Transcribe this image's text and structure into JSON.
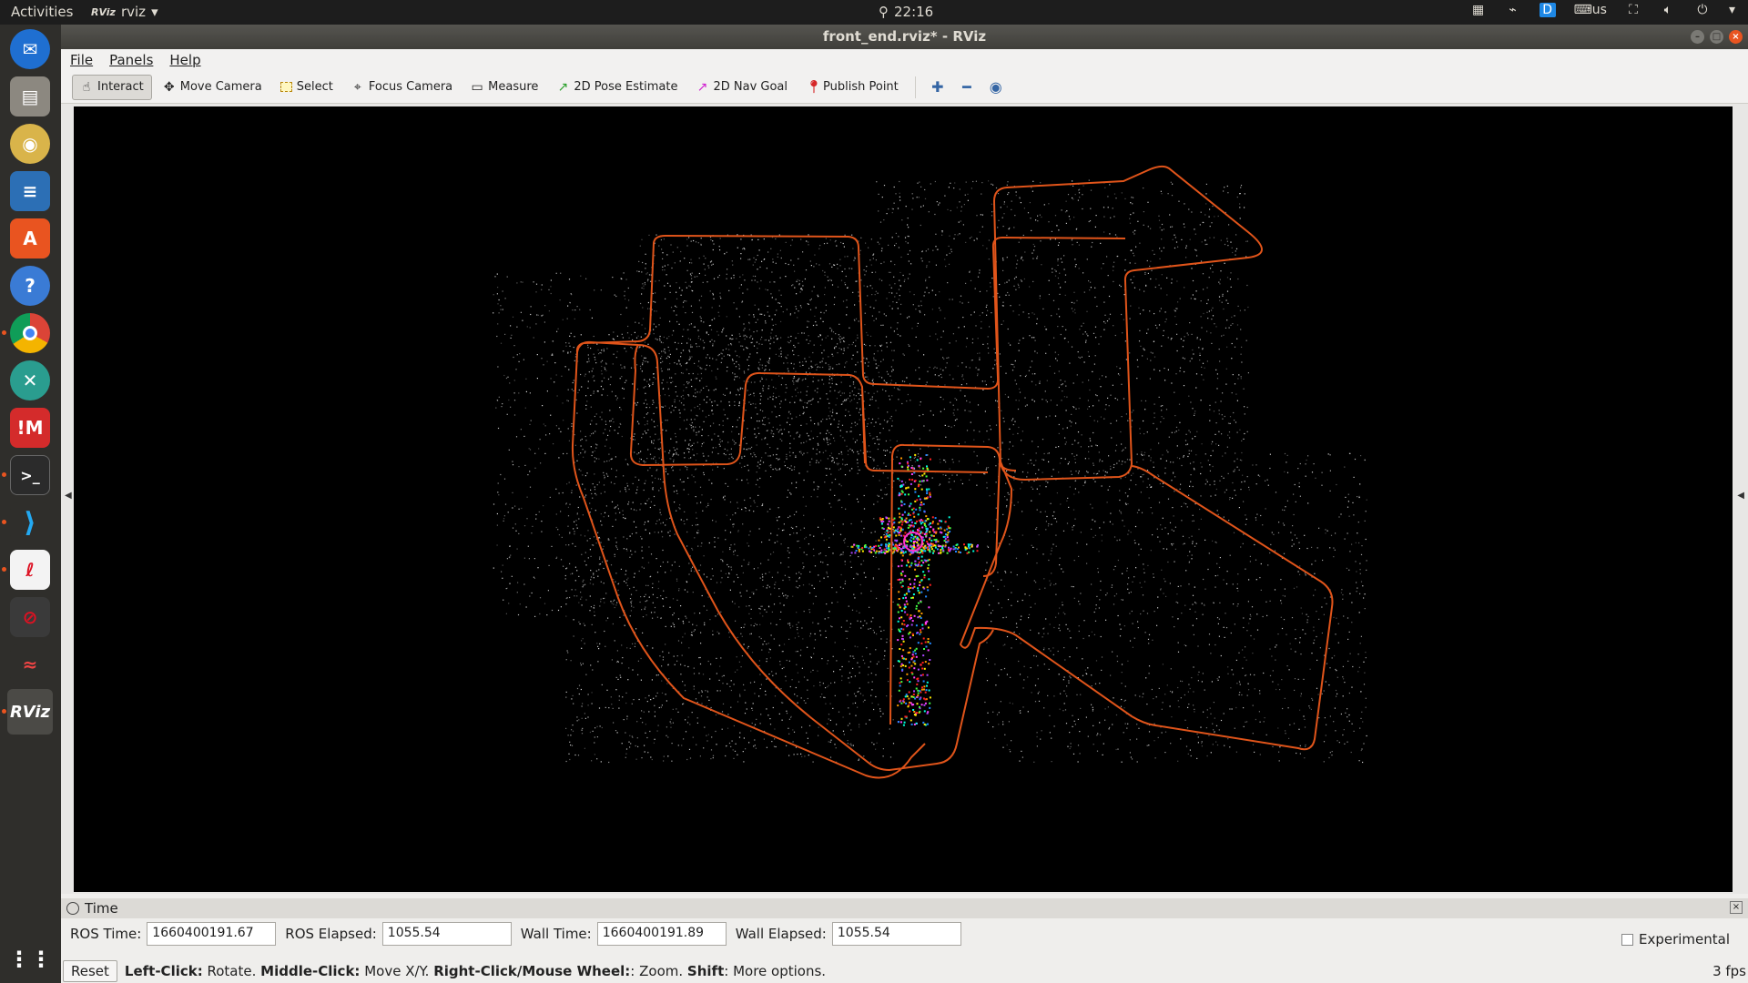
{
  "topbar": {
    "activities": "Activities",
    "app_name": "rviz",
    "app_badge": "RViz",
    "time": "22:16",
    "keyboard": "us"
  },
  "dock": {
    "items": [
      "thunderbird-icon",
      "files-icon",
      "rhythmbox-icon",
      "libreoffice-writer-icon",
      "software-center-icon",
      "help-icon",
      "chrome-icon",
      "app-x-icon",
      "imagemagick-icon",
      "terminal-icon",
      "vscode-icon",
      "document-viewer-icon",
      "app-blocked-icon",
      "kdenlive-icon",
      "rviz-icon",
      "app-grid-icon"
    ],
    "rviz_label": "RViz"
  },
  "window": {
    "title": "front_end.rviz* - RViz"
  },
  "menu": {
    "file": "File",
    "panels": "Panels",
    "help": "Help"
  },
  "toolbar": {
    "interact": "Interact",
    "move_camera": "Move Camera",
    "select": "Select",
    "focus_camera": "Focus Camera",
    "measure": "Measure",
    "pose_estimate": "2D Pose Estimate",
    "nav_goal": "2D Nav Goal",
    "publish_point": "Publish Point"
  },
  "time_panel": {
    "title": "Time",
    "ros_time_label": "ROS Time:",
    "ros_time": "1660400191.67",
    "ros_elapsed_label": "ROS Elapsed:",
    "ros_elapsed": "1055.54",
    "wall_time_label": "Wall Time:",
    "wall_time": "1660400191.89",
    "wall_elapsed_label": "Wall Elapsed:",
    "wall_elapsed": "1055.54",
    "experimental": "Experimental"
  },
  "status": {
    "reset": "Reset",
    "hint_left_b": "Left-Click:",
    "hint_left": "Rotate.",
    "hint_mid_b": "Middle-Click:",
    "hint_mid": "Move X/Y.",
    "hint_right_b": "Right-Click/Mouse Wheel:",
    "hint_right": ": Zoom.",
    "hint_shift_b": "Shift",
    "hint_shift": ": More options.",
    "fps": "3 fps"
  },
  "colors": {
    "trajectory": "#e0541a",
    "background": "#000000",
    "ubuntu_accent": "#e95420"
  }
}
